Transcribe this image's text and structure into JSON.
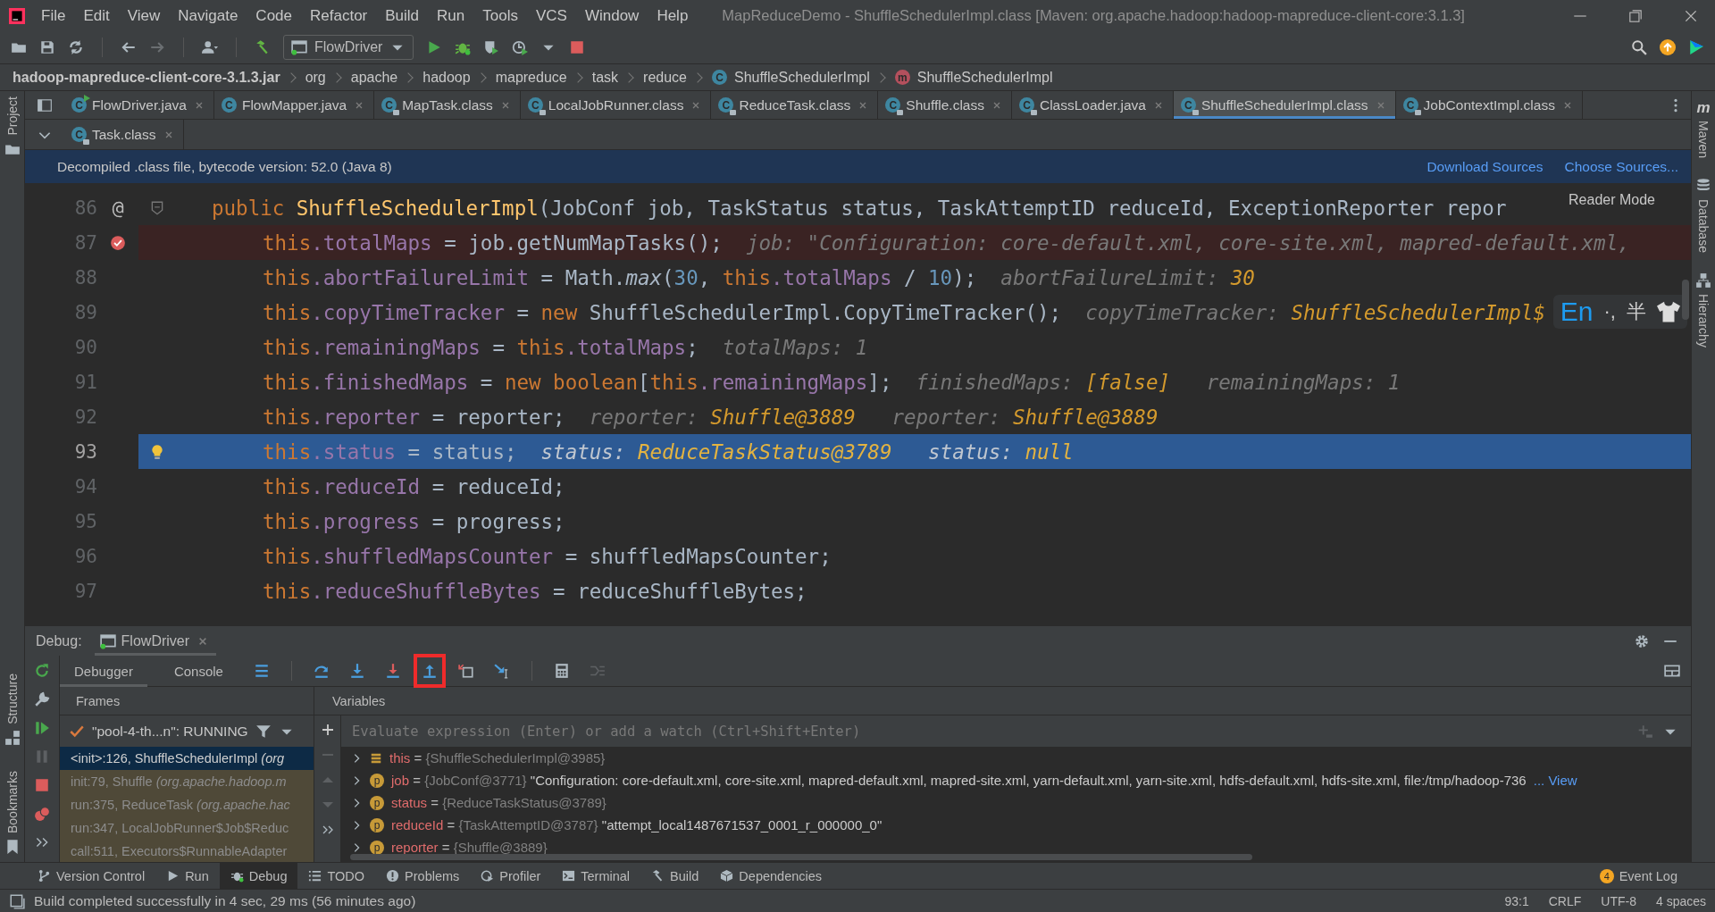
{
  "window": {
    "title": "MapReduceDemo - ShuffleSchedulerImpl.class [Maven: org.apache.hadoop:hadoop-mapreduce-client-core:3.1.3]"
  },
  "menu": [
    "File",
    "Edit",
    "View",
    "Navigate",
    "Code",
    "Refactor",
    "Build",
    "Run",
    "Tools",
    "VCS",
    "Window",
    "Help"
  ],
  "toolbar": {
    "run_config": "FlowDriver"
  },
  "breadcrumbs": [
    {
      "label": "hadoop-mapreduce-client-core-3.1.3.jar",
      "kind": "jar"
    },
    {
      "label": "org",
      "kind": "package"
    },
    {
      "label": "apache",
      "kind": "package"
    },
    {
      "label": "hadoop",
      "kind": "package"
    },
    {
      "label": "mapreduce",
      "kind": "package"
    },
    {
      "label": "task",
      "kind": "package"
    },
    {
      "label": "reduce",
      "kind": "package"
    },
    {
      "label": "ShuffleSchedulerImpl",
      "kind": "class",
      "icon": "C"
    },
    {
      "label": "ShuffleSchedulerImpl",
      "kind": "method",
      "icon": "m"
    }
  ],
  "editor_tabs": [
    {
      "label": "FlowDriver.java",
      "icon": "C",
      "locked": false,
      "runnable": true,
      "selected": false
    },
    {
      "label": "FlowMapper.java",
      "icon": "C",
      "locked": false,
      "runnable": false,
      "selected": false
    },
    {
      "label": "MapTask.class",
      "icon": "C",
      "locked": true,
      "runnable": false,
      "selected": false
    },
    {
      "label": "LocalJobRunner.class",
      "icon": "C",
      "locked": true,
      "runnable": false,
      "selected": false
    },
    {
      "label": "ReduceTask.class",
      "icon": "C",
      "locked": true,
      "runnable": false,
      "selected": false
    },
    {
      "label": "Shuffle.class",
      "icon": "C",
      "locked": true,
      "runnable": false,
      "selected": false
    },
    {
      "label": "ClassLoader.java",
      "icon": "C",
      "locked": true,
      "runnable": false,
      "selected": false
    },
    {
      "label": "ShuffleSchedulerImpl.class",
      "icon": "C",
      "locked": true,
      "runnable": false,
      "selected": true
    },
    {
      "label": "JobContextImpl.class",
      "icon": "C",
      "locked": true,
      "runnable": false,
      "selected": false
    }
  ],
  "editor_tabs_row2": [
    {
      "label": "Task.class",
      "icon": "C",
      "locked": true,
      "runnable": false,
      "selected": false
    }
  ],
  "banner": {
    "text": "Decompiled .class file, bytecode version: 52.0 (Java 8)",
    "links": [
      "Download Sources",
      "Choose Sources..."
    ]
  },
  "reader_mode": "Reader Mode",
  "editor": {
    "lines": [
      {
        "number": "86",
        "breakpoint": false,
        "current": false,
        "fold": true,
        "bulb": false,
        "marker": "@",
        "segments": [
          {
            "kind": "keyword",
            "text": "public "
          },
          {
            "kind": "method",
            "text": "ShuffleSchedulerImpl"
          },
          {
            "kind": "plain",
            "text": "(JobConf job, TaskStatus status, TaskAttemptID reduceId, ExceptionReporter repor"
          }
        ]
      },
      {
        "number": "87",
        "breakpoint": true,
        "current": false,
        "fold": false,
        "bulb": false,
        "segments": [
          {
            "kind": "keyword",
            "text": "this"
          },
          {
            "kind": "field",
            "text": ".totalMaps"
          },
          {
            "kind": "plain",
            "text": " = job.getNumMapTasks();"
          },
          {
            "kind": "hint",
            "text": "  job: \"Configuration: core-default.xml, core-site.xml, mapred-default.xml,"
          }
        ]
      },
      {
        "number": "88",
        "breakpoint": false,
        "current": false,
        "fold": false,
        "bulb": false,
        "segments": [
          {
            "kind": "keyword",
            "text": "this"
          },
          {
            "kind": "field",
            "text": ".abortFailureLimit"
          },
          {
            "kind": "plain",
            "text": " = Math."
          },
          {
            "kind": "static",
            "text": "max"
          },
          {
            "kind": "plain",
            "text": "("
          },
          {
            "kind": "number",
            "text": "30"
          },
          {
            "kind": "plain",
            "text": ", "
          },
          {
            "kind": "keyword",
            "text": "this"
          },
          {
            "kind": "field",
            "text": ".totalMaps"
          },
          {
            "kind": "plain",
            "text": " / "
          },
          {
            "kind": "number",
            "text": "10"
          },
          {
            "kind": "plain",
            "text": ");"
          },
          {
            "kind": "hint",
            "text": "  abortFailureLimit: "
          },
          {
            "kind": "value",
            "text": "30"
          }
        ]
      },
      {
        "number": "89",
        "breakpoint": false,
        "current": false,
        "fold": false,
        "bulb": false,
        "segments": [
          {
            "kind": "keyword",
            "text": "this"
          },
          {
            "kind": "field",
            "text": ".copyTimeTracker"
          },
          {
            "kind": "plain",
            "text": " = "
          },
          {
            "kind": "keyword",
            "text": "new"
          },
          {
            "kind": "plain",
            "text": " ShuffleSchedulerImpl.CopyTimeTracker();"
          },
          {
            "kind": "hint",
            "text": "  copyTimeTracker: "
          },
          {
            "kind": "value",
            "text": "ShuffleSchedulerImpl$"
          }
        ]
      },
      {
        "number": "90",
        "breakpoint": false,
        "current": false,
        "fold": false,
        "bulb": false,
        "segments": [
          {
            "kind": "keyword",
            "text": "this"
          },
          {
            "kind": "field",
            "text": ".remainingMaps"
          },
          {
            "kind": "plain",
            "text": " = "
          },
          {
            "kind": "keyword",
            "text": "this"
          },
          {
            "kind": "field",
            "text": ".totalMaps"
          },
          {
            "kind": "plain",
            "text": ";"
          },
          {
            "kind": "hint",
            "text": "  totalMaps: 1"
          }
        ]
      },
      {
        "number": "91",
        "breakpoint": false,
        "current": false,
        "fold": false,
        "bulb": false,
        "segments": [
          {
            "kind": "keyword",
            "text": "this"
          },
          {
            "kind": "field",
            "text": ".finishedMaps"
          },
          {
            "kind": "plain",
            "text": " = "
          },
          {
            "kind": "keyword",
            "text": "new boolean"
          },
          {
            "kind": "plain",
            "text": "["
          },
          {
            "kind": "keyword",
            "text": "this"
          },
          {
            "kind": "field",
            "text": ".remainingMaps"
          },
          {
            "kind": "plain",
            "text": "];"
          },
          {
            "kind": "hint",
            "text": "  finishedMaps: "
          },
          {
            "kind": "value",
            "text": "[false]"
          },
          {
            "kind": "hint",
            "text": "   remainingMaps: 1"
          }
        ]
      },
      {
        "number": "92",
        "breakpoint": false,
        "current": false,
        "fold": false,
        "bulb": false,
        "segments": [
          {
            "kind": "keyword",
            "text": "this"
          },
          {
            "kind": "field",
            "text": ".reporter"
          },
          {
            "kind": "plain",
            "text": " = reporter;"
          },
          {
            "kind": "hint",
            "text": "  reporter: "
          },
          {
            "kind": "value",
            "text": "Shuffle@3889"
          },
          {
            "kind": "hint",
            "text": "   reporter: "
          },
          {
            "kind": "value",
            "text": "Shuffle@3889"
          }
        ]
      },
      {
        "number": "93",
        "breakpoint": false,
        "current": true,
        "fold": false,
        "bulb": true,
        "segments": [
          {
            "kind": "keyword",
            "text": "this"
          },
          {
            "kind": "field",
            "text": ".status"
          },
          {
            "kind": "plain",
            "text": " = status;"
          },
          {
            "kind": "hint",
            "text": "  status: "
          },
          {
            "kind": "value",
            "text": "ReduceTaskStatus@3789"
          },
          {
            "kind": "hint",
            "text": "   status: "
          },
          {
            "kind": "value",
            "text": "null"
          }
        ]
      },
      {
        "number": "94",
        "breakpoint": false,
        "current": false,
        "fold": false,
        "bulb": false,
        "segments": [
          {
            "kind": "keyword",
            "text": "this"
          },
          {
            "kind": "field",
            "text": ".reduceId"
          },
          {
            "kind": "plain",
            "text": " = reduceId;"
          }
        ]
      },
      {
        "number": "95",
        "breakpoint": false,
        "current": false,
        "fold": false,
        "bulb": false,
        "segments": [
          {
            "kind": "keyword",
            "text": "this"
          },
          {
            "kind": "field",
            "text": ".progress"
          },
          {
            "kind": "plain",
            "text": " = progress;"
          }
        ]
      },
      {
        "number": "96",
        "breakpoint": false,
        "current": false,
        "fold": false,
        "bulb": false,
        "segments": [
          {
            "kind": "keyword",
            "text": "this"
          },
          {
            "kind": "field",
            "text": ".shuffledMapsCounter"
          },
          {
            "kind": "plain",
            "text": " = shuffledMapsCounter;"
          }
        ]
      },
      {
        "number": "97",
        "breakpoint": false,
        "current": false,
        "fold": false,
        "bulb": false,
        "segments": [
          {
            "kind": "keyword",
            "text": "this"
          },
          {
            "kind": "field",
            "text": ".reduceShuffleBytes"
          },
          {
            "kind": "plain",
            "text": " = reduceShuffleBytes;"
          }
        ]
      }
    ]
  },
  "ime": {
    "language": "En",
    "punctuation": "·,",
    "width": "半"
  },
  "left_panels": {
    "top": [
      "Project"
    ],
    "bottom": [
      "Structure",
      "Bookmarks"
    ]
  },
  "right_panels": [
    {
      "label": "Maven",
      "icon": "m"
    },
    {
      "label": "Database"
    },
    {
      "label": "Hierarchy"
    }
  ],
  "debug": {
    "label": "Debug:",
    "session": "FlowDriver",
    "tabs": [
      {
        "label": "Debugger",
        "selected": true
      },
      {
        "label": "Console",
        "selected": false
      }
    ],
    "buttons": [
      {
        "kind": "layout",
        "highlighted": false
      },
      {
        "kind": "step-over",
        "highlighted": false
      },
      {
        "kind": "step-into",
        "highlighted": false
      },
      {
        "kind": "force-step-into",
        "highlighted": false
      },
      {
        "kind": "step-out",
        "highlighted": true
      },
      {
        "kind": "drop-frame",
        "highlighted": false
      },
      {
        "kind": "run-to-cursor",
        "highlighted": false
      },
      {
        "kind": "evaluate",
        "highlighted": false
      },
      {
        "kind": "trace",
        "highlighted": false
      }
    ],
    "frames_title": "Frames",
    "variables_title": "Variables",
    "thread": "\"pool-4-th...n\": RUNNING",
    "frames": [
      {
        "text": "<init>:126, ShuffleSchedulerImpl *(org*",
        "selected": true,
        "library": false
      },
      {
        "text": "init:79, Shuffle *(org.apache.hadoop.m*",
        "selected": false,
        "library": true
      },
      {
        "text": "run:375, ReduceTask *(org.apache.hac*",
        "selected": false,
        "library": true
      },
      {
        "text": "run:347, LocalJobRunner$Job$Reduc",
        "selected": false,
        "library": true
      },
      {
        "text": "call:511, Executors$RunnableAdapter",
        "selected": false,
        "library": true
      }
    ],
    "evaluate_placeholder": "Evaluate expression (Enter) or add a watch (Ctrl+Shift+Enter)",
    "variables": [
      {
        "name": "this",
        "kind": "object",
        "equals": "=",
        "value": "{ShuffleSchedulerImpl@3985}"
      },
      {
        "name": "job",
        "kind": "param",
        "badge": "p",
        "equals": "=",
        "value": "{JobConf@3771}",
        "detail": "\"Configuration: core-default.xml, core-site.xml, mapred-default.xml, mapred-site.xml, yarn-default.xml, yarn-site.xml, hdfs-default.xml, hdfs-site.xml, file:/tmp/hadoop-736",
        "link": "... View"
      },
      {
        "name": "status",
        "kind": "param",
        "badge": "p",
        "equals": "=",
        "value": "{ReduceTaskStatus@3789}"
      },
      {
        "name": "reduceId",
        "kind": "param",
        "badge": "p",
        "equals": "=",
        "value": "{TaskAttemptID@3787}",
        "detail": "\"attempt_local1487671537_0001_r_000000_0\""
      },
      {
        "name": "reporter",
        "kind": "param",
        "badge": "p",
        "equals": "=",
        "value": "{Shuffle@3889}"
      }
    ]
  },
  "tool_windows": [
    {
      "label": "Version Control",
      "kind": "vcs",
      "selected": false
    },
    {
      "label": "Run",
      "kind": "run",
      "selected": false
    },
    {
      "label": "Debug",
      "kind": "debug",
      "selected": true
    },
    {
      "label": "TODO",
      "kind": "todo",
      "selected": false
    },
    {
      "label": "Problems",
      "kind": "problems",
      "selected": false
    },
    {
      "label": "Profiler",
      "kind": "profiler",
      "selected": false
    },
    {
      "label": "Terminal",
      "kind": "terminal",
      "selected": false
    },
    {
      "label": "Build",
      "kind": "build",
      "selected": false
    },
    {
      "label": "Dependencies",
      "kind": "dependencies",
      "selected": false
    }
  ],
  "event_log": {
    "count": "4",
    "label": "Event Log"
  },
  "status_bar": {
    "message": "Build completed successfully in 4 sec, 29 ms (56 minutes ago)",
    "items": [
      "93:1",
      "CRLF",
      "UTF-8",
      "4 spaces"
    ]
  }
}
